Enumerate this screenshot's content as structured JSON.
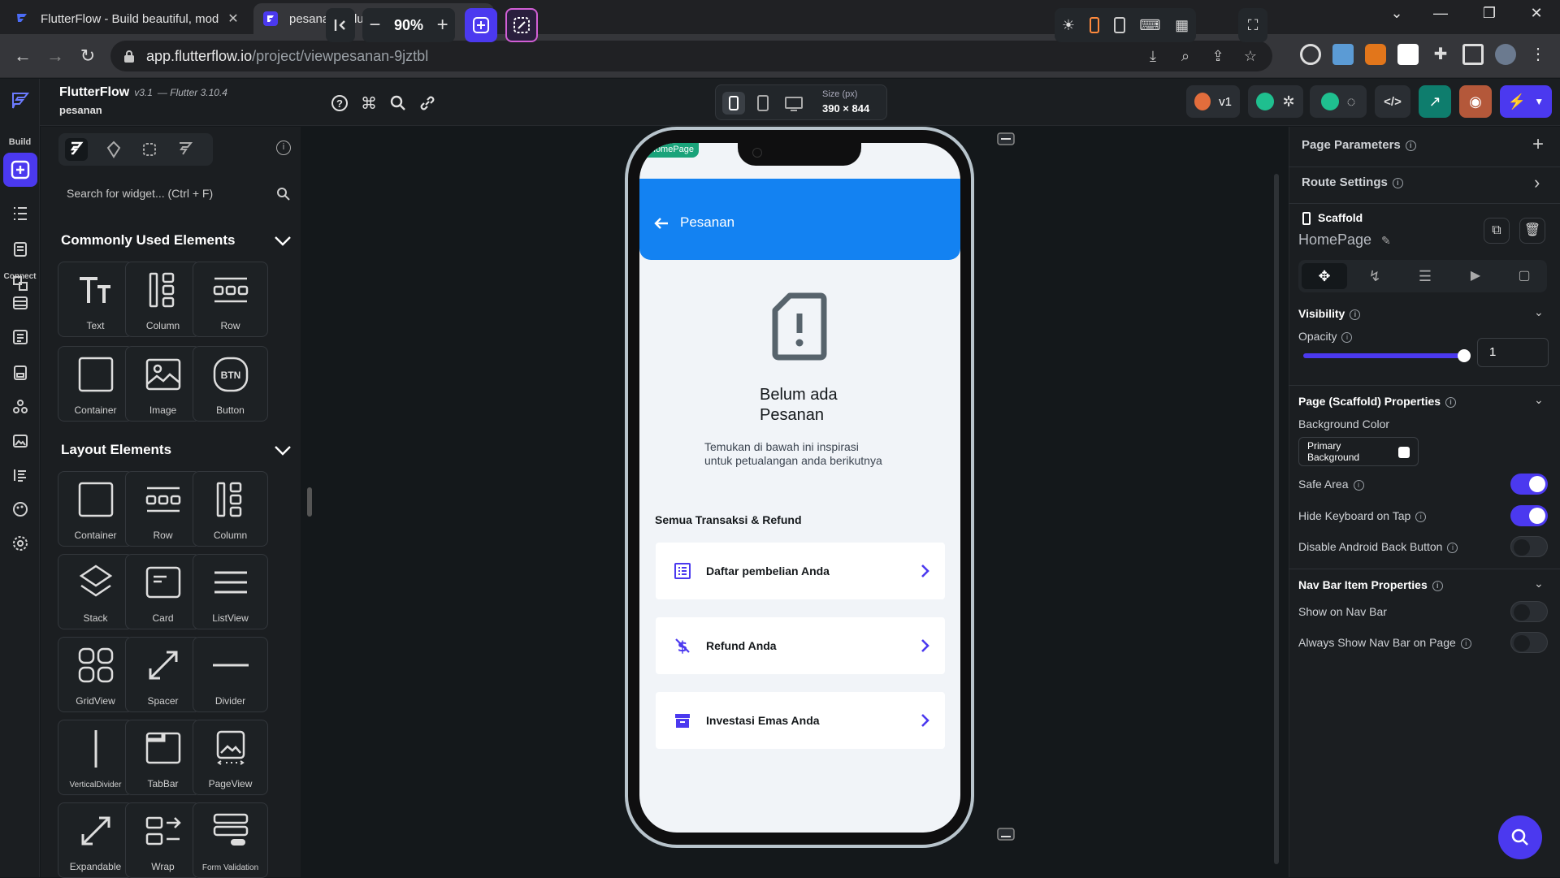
{
  "browser": {
    "tabs": [
      {
        "title": "FlutterFlow - Build beautiful, mod",
        "close": "✕"
      },
      {
        "title": "pesanan - FlutterFlow",
        "close": "✕"
      }
    ],
    "new_tab": "+",
    "url_host": "app.flutterflow.io",
    "url_path": "/project/viewpesanan-9jztbl"
  },
  "header": {
    "app_name": "FlutterFlow",
    "version": "v3.1",
    "flutter_version": "— Flutter 3.10.4",
    "project": "pesanan",
    "size_label": "Size (px)",
    "size_value": "390 × 844",
    "version_badge": "v1"
  },
  "rail": {
    "build_label": "Build",
    "connect_label": "Connect"
  },
  "widget_panel": {
    "search_placeholder": "Search for widget... (Ctrl + F)",
    "common_title": "Commonly Used Elements",
    "common": [
      "Text",
      "Column",
      "Row",
      "Container",
      "Image",
      "Button"
    ],
    "layout_title": "Layout Elements",
    "layout": [
      "Container",
      "Row",
      "Column",
      "Stack",
      "Card",
      "ListView",
      "GridView",
      "Spacer",
      "Divider",
      "VerticalDivider",
      "TabBar",
      "PageView",
      "Expandable",
      "Wrap",
      "Form Validation"
    ]
  },
  "canvas": {
    "zoom": "90%",
    "page_tag": "HomePage"
  },
  "app": {
    "appbar_title": "Pesanan",
    "empty_title": "Belum ada\nPesanan",
    "empty_subtitle": "Temukan di bawah ini inspirasi\nuntuk petualangan anda berikutnya",
    "section_title": "Semua Transaksi & Refund",
    "cards": [
      "Daftar pembelian Anda",
      "Refund Anda",
      "Investasi Emas Anda"
    ]
  },
  "properties": {
    "page_parameters": "Page Parameters",
    "route_settings": "Route Settings",
    "widget_type": "Scaffold",
    "widget_name": "HomePage",
    "visibility": "Visibility",
    "opacity_label": "Opacity",
    "opacity_value": "1",
    "opacity": 1,
    "scaffold_props": "Page (Scaffold) Properties",
    "bg_color_label": "Background Color",
    "bg_color_value": "Primary Background",
    "safe_area": "Safe Area",
    "hide_keyboard": "Hide Keyboard on Tap",
    "disable_back": "Disable Android Back Button",
    "navbar_props": "Nav Bar Item Properties",
    "show_navbar": "Show on Nav Bar",
    "always_navbar": "Always Show Nav Bar on Page"
  },
  "colors": {
    "accent": "#4b39ef",
    "appbar": "#1382f2",
    "success": "#1aa37a"
  }
}
